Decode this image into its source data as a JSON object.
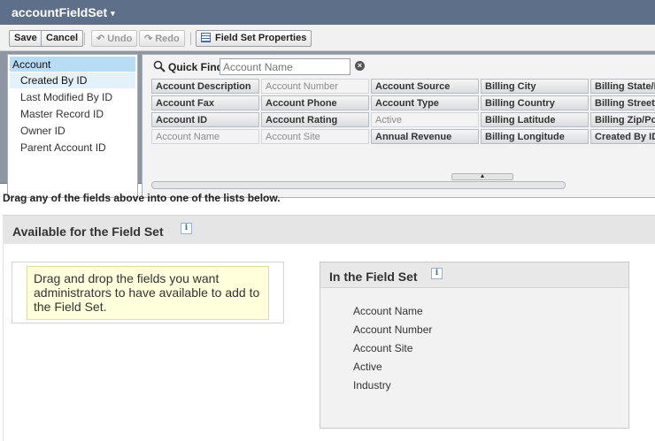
{
  "title_bar": {
    "title": "accountFieldSet",
    "caret": "▾"
  },
  "toolbar": {
    "save": "Save",
    "cancel": "Cancel",
    "undo": "Undo",
    "redo": "Redo",
    "properties": "Field Set Properties"
  },
  "object_list": {
    "header": "Account",
    "items": [
      "Created By ID",
      "Last Modified By ID",
      "Master Record ID",
      "Owner ID",
      "Parent Account ID"
    ],
    "selected": "Created By ID"
  },
  "quick_find": {
    "label": "Quick Find",
    "placeholder": "Account Name",
    "clear": "×"
  },
  "fields": {
    "col1": [
      "Account Description",
      "Account Fax",
      "Account ID",
      "Account Name"
    ],
    "col2": [
      "Account Number",
      "Account Phone",
      "Account Rating",
      "Account Site"
    ],
    "col3": [
      "Account Source",
      "Account Type",
      "Active",
      "Annual Revenue"
    ],
    "col4": [
      "Billing City",
      "Billing Country",
      "Billing Latitude",
      "Billing Longitude"
    ],
    "col5": [
      "Billing State/Province",
      "Billing Street",
      "Billing Zip/Postal Code",
      "Created By ID"
    ],
    "used": [
      "Account Number",
      "Account Name",
      "Account Site",
      "Active"
    ]
  },
  "splitter": "▲",
  "drag_hint": "Drag any of the fields above into one of the lists below.",
  "available": {
    "title": "Available for the Field Set",
    "info": "i",
    "hint": "Drag and drop the fields you want administrators to have available to add to the Field Set."
  },
  "in_field_set": {
    "title": "In the Field Set",
    "info": "i",
    "items": [
      "Account Name",
      "Account Number",
      "Account Site",
      "Active",
      "Industry"
    ]
  }
}
